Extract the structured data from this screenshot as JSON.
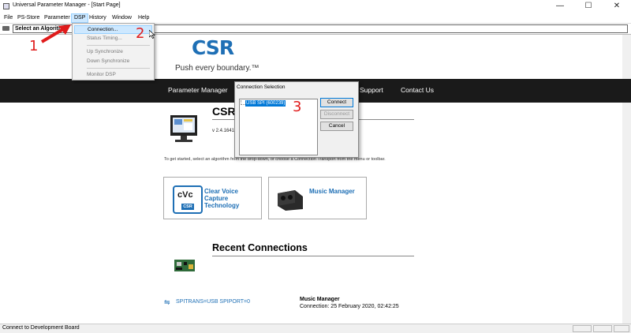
{
  "window": {
    "title": "Universal Parameter Manager - [Start Page]",
    "minimize_glyph": "—",
    "maximize_glyph": "☐",
    "close_glyph": "✕"
  },
  "menubar": {
    "items": [
      "File",
      "PS-Store",
      "Parameter",
      "DSP",
      "History",
      "Window",
      "Help"
    ],
    "active": "DSP"
  },
  "toolbar": {
    "algorithm_select_value": "Select an Algorithm"
  },
  "dsp_menu": {
    "items": [
      {
        "label": "Connection...",
        "enabled": true,
        "highlighted": true
      },
      {
        "label": "Status Timing...",
        "enabled": false
      },
      {
        "label": "Up Synchronize",
        "enabled": false
      },
      {
        "label": "Down Synchronize",
        "enabled": false
      },
      {
        "label": "Monitor DSP",
        "enabled": false
      }
    ]
  },
  "brand": {
    "logo_text": "CSR",
    "tagline": "Push every boundary.™",
    "color": "#1e6fb5"
  },
  "nav": {
    "items": [
      "Parameter Manager",
      "Support",
      "Contact Us"
    ]
  },
  "content": {
    "heading": "CSR",
    "version": "v 2.4.1641",
    "intro": "To get started, select an algorithm from the drop-down, or choose a Connection Transport from the menu or toolbar.",
    "cards": [
      {
        "title_line1": "Clear Voice",
        "title_line2": "Capture",
        "title_line3": "Technology",
        "icon": "cvc-logo",
        "icon_text": "cVc",
        "icon_sub": "CSR"
      },
      {
        "title_line1": "Music Manager",
        "icon": "speaker-icon"
      }
    ],
    "recent_heading": "Recent Connections",
    "recent": {
      "link": "SPITRANS=USB SPIPORT=0",
      "name": "Music Manager",
      "date": "Connection: 25 February 2020, 02:42:25"
    }
  },
  "dialog": {
    "title": "Connection Selection",
    "list_item": "USB SPI (600239)",
    "buttons": [
      {
        "label": "Connect",
        "enabled": true
      },
      {
        "label": "Disconnect",
        "enabled": false
      },
      {
        "label": "Cancel",
        "enabled": true
      }
    ]
  },
  "annotations": [
    "1",
    "2",
    "3"
  ],
  "statusbar": {
    "text": "Connect to Development Board"
  }
}
